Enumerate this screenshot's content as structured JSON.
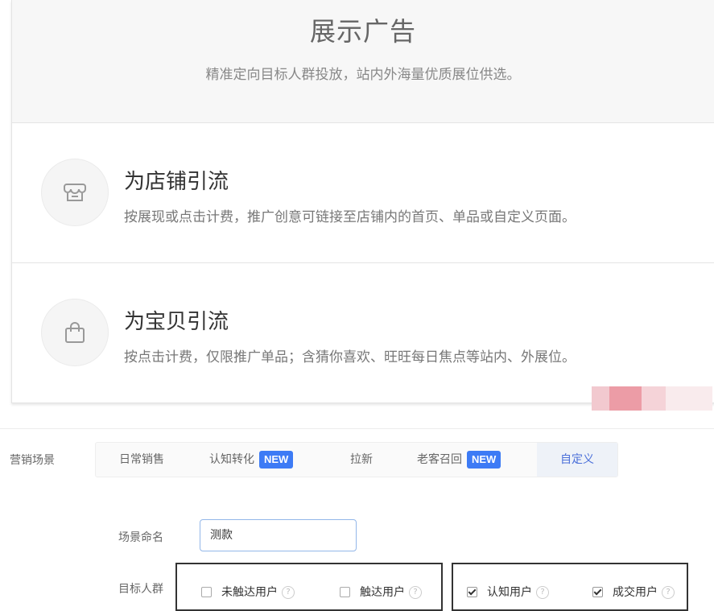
{
  "display_ad": {
    "title": "展示广告",
    "subtitle": "精准定向目标人群投放，站内外海量优质展位供选。"
  },
  "options": [
    {
      "icon": "store-icon",
      "title": "为店铺引流",
      "description": "按展现或点击计费，推广创意可链接至店铺内的首页、单品或自定义页面。"
    },
    {
      "icon": "shopping-bag-icon",
      "title": "为宝贝引流",
      "description": "按点击计费，仅限推广单品；含猜你喜欢、旺旺每日焦点等站内、外展位。"
    }
  ],
  "marketing": {
    "label": "营销场景",
    "tabs": [
      {
        "label": "日常销售",
        "badge": ""
      },
      {
        "label": "认知转化",
        "badge": "NEW"
      },
      {
        "label": "拉新",
        "badge": ""
      },
      {
        "label": "老客召回",
        "badge": "NEW"
      },
      {
        "label": "自定义",
        "badge": ""
      }
    ],
    "active_tab": "自定义"
  },
  "scene_name": {
    "label": "场景命名",
    "value": "测款"
  },
  "target_audience": {
    "label": "目标人群",
    "options": [
      {
        "label": "未触达用户",
        "checked": false
      },
      {
        "label": "触达用户",
        "checked": false
      },
      {
        "label": "认知用户",
        "checked": true
      },
      {
        "label": "成交用户",
        "checked": true
      }
    ],
    "help_glyph": "?"
  },
  "colors": {
    "accent": "#3d7bf5",
    "active_tab_text": "#4a6fd9",
    "input_border": "#93b7e9"
  }
}
